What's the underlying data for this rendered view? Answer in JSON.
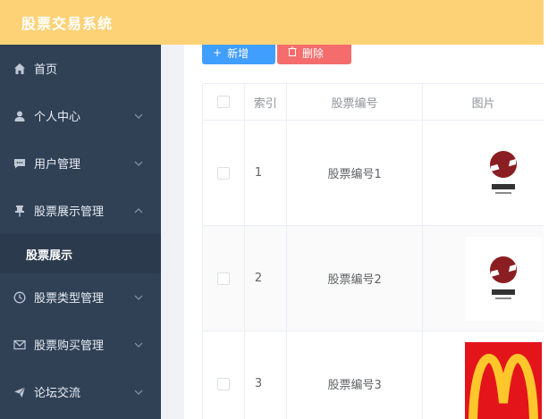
{
  "app": {
    "title": "股票交易系统"
  },
  "sidebar": {
    "items": [
      {
        "label": "首页",
        "icon": "home-icon"
      },
      {
        "label": "个人中心",
        "icon": "user-icon"
      },
      {
        "label": "用户管理",
        "icon": "chat-icon"
      },
      {
        "label": "股票展示管理",
        "icon": "pin-icon",
        "expanded": true,
        "children": [
          {
            "label": "股票展示"
          }
        ]
      },
      {
        "label": "股票类型管理",
        "icon": "clock-icon"
      },
      {
        "label": "股票购买管理",
        "icon": "mail-icon"
      },
      {
        "label": "论坛交流",
        "icon": "send-icon"
      }
    ]
  },
  "toolbar": {
    "add_label": "新增",
    "delete_label": "删除"
  },
  "table": {
    "columns": [
      "索引",
      "股票编号",
      "图片"
    ],
    "rows": [
      {
        "index": "1",
        "code": "股票编号1",
        "image": "tongling-logo"
      },
      {
        "index": "2",
        "code": "股票编号2",
        "image": "tongling-logo"
      },
      {
        "index": "3",
        "code": "股票编号3",
        "image": "mcdonalds-logo"
      }
    ]
  },
  "colors": {
    "header": "#fdd277",
    "sidebar": "#304156",
    "primary": "#409eff",
    "danger": "#f56c6c"
  }
}
